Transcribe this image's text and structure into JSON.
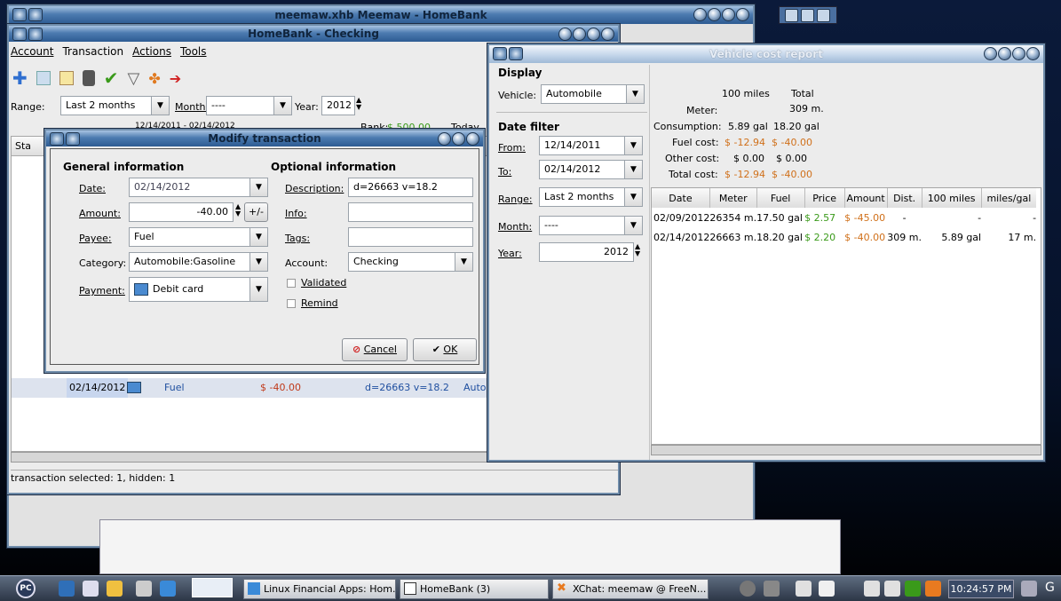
{
  "main_window": {
    "title": "meemaw.xhb Meemaw - HomeBank"
  },
  "checking_window": {
    "title": "HomeBank - Checking",
    "menu": [
      "Account",
      "Transaction",
      "Actions",
      "Tools"
    ],
    "range_label": "Range:",
    "range_value": "Last 2 months",
    "month_label": "Month:",
    "month_value": "----",
    "year_label": "Year:",
    "year_value": "2012",
    "date_range": "12/14/2011 - 02/14/2012",
    "bank_label": "Bank:",
    "bank_value": "$ 500.00",
    "today_label": "Today",
    "col_stat": "Sta",
    "row": {
      "date": "02/14/2012",
      "payee": "Fuel",
      "amount": "$ -40.00",
      "memo": "d=26663 v=18.2",
      "category": "Autom"
    },
    "status": "transaction selected: 1, hidden: 1"
  },
  "modify_dialog": {
    "title": "Modify transaction",
    "general_heading": "General information",
    "optional_heading": "Optional information",
    "date_label": "Date:",
    "date_value": "02/14/2012",
    "amount_label": "Amount:",
    "amount_value": "-40.00",
    "amount_toggle": "+/-",
    "payee_label": "Payee:",
    "payee_value": "Fuel",
    "category_label": "Category:",
    "category_value": "Automobile:Gasoline",
    "payment_label": "Payment:",
    "payment_value": "Debit card",
    "description_label": "Description:",
    "description_value": "d=26663 v=18.2",
    "info_label": "Info:",
    "info_value": "",
    "tags_label": "Tags:",
    "tags_value": "",
    "account_label": "Account:",
    "account_value": "Checking",
    "validated_label": "Validated",
    "remind_label": "Remind",
    "cancel_label": "Cancel",
    "ok_label": "OK"
  },
  "vehicle_window": {
    "title": "Vehicle cost report",
    "display_heading": "Display",
    "vehicle_label": "Vehicle:",
    "vehicle_value": "Automobile",
    "datefilter_heading": "Date filter",
    "from_label": "From:",
    "from_value": "12/14/2011",
    "to_label": "To:",
    "to_value": "02/14/2012",
    "range_label": "Range:",
    "range_value": "Last 2 months",
    "month_label": "Month:",
    "month_value": "----",
    "year_label": "Year:",
    "year_value": "2012",
    "summary": {
      "col1": "100 miles",
      "col2": "Total",
      "meter_label": "Meter:",
      "meter_total": "309 m.",
      "consumption_label": "Consumption:",
      "consumption_100": "5.89 gal",
      "consumption_total": "18.20 gal",
      "fuel_label": "Fuel cost:",
      "fuel_100": "$ -12.94",
      "fuel_total": "$ -40.00",
      "other_label": "Other cost:",
      "other_100": "$ 0.00",
      "other_total": "$ 0.00",
      "total_label": "Total cost:",
      "total_100": "$ -12.94",
      "total_total": "$ -40.00"
    },
    "columns": [
      "Date",
      "Meter",
      "Fuel",
      "Price",
      "Amount",
      "Dist.",
      "100 miles",
      "miles/gal"
    ],
    "rows": [
      {
        "date": "02/09/2012",
        "meter": "26354 m.",
        "fuel": "17.50 gal",
        "price": "$ 2.57",
        "amount": "$ -45.00",
        "dist": "-",
        "per100": "-",
        "mpg": "-"
      },
      {
        "date": "02/14/2012",
        "meter": "26663 m.",
        "fuel": "18.20 gal",
        "price": "$ 2.20",
        "amount": "$ -40.00",
        "dist": "309 m.",
        "per100": "5.89 gal",
        "mpg": "17 m."
      }
    ]
  },
  "taskbar": {
    "start_label": "PC",
    "items": [
      "Linux Financial Apps: Hom...",
      "HomeBank (3)",
      "XChat: meemaw @ FreeN..."
    ],
    "clock": "10:24:57 PM"
  }
}
